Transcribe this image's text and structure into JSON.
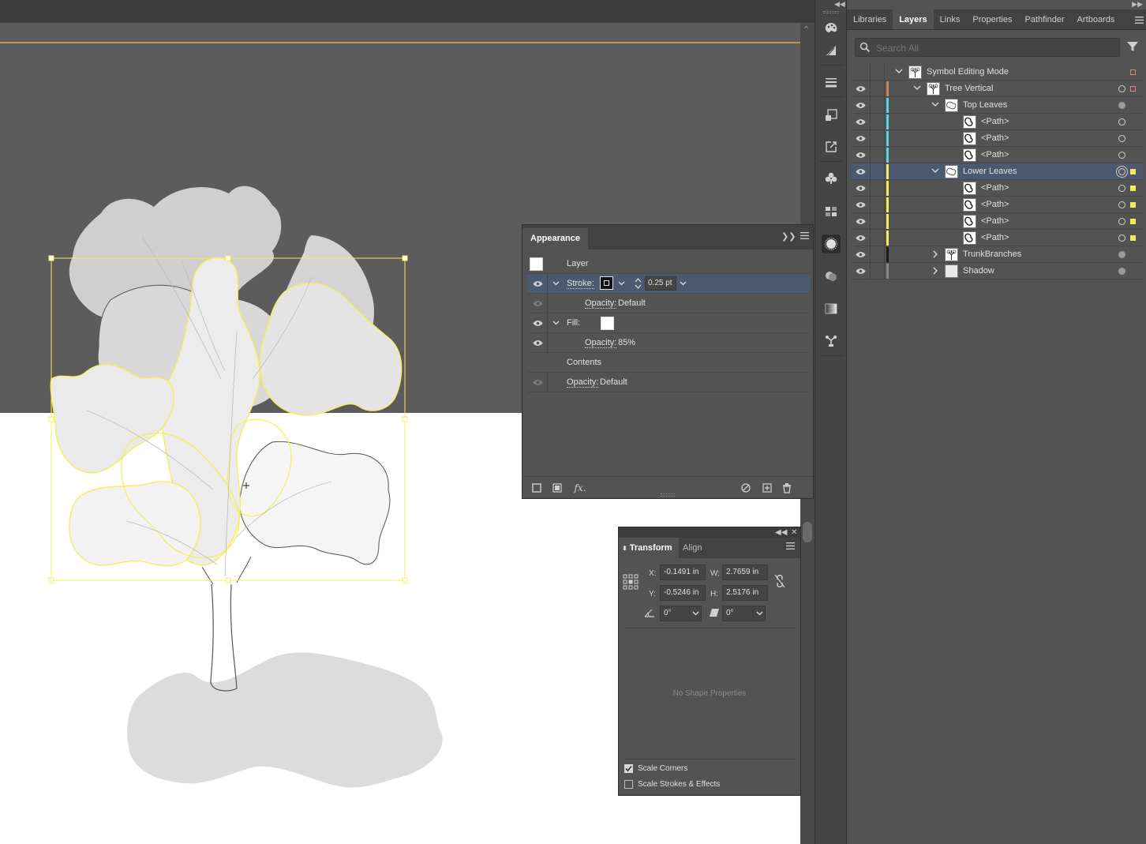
{
  "right_panel": {
    "tabs": [
      {
        "label": "Libraries",
        "active": false
      },
      {
        "label": "Layers",
        "active": true
      },
      {
        "label": "Links",
        "active": false
      },
      {
        "label": "Properties",
        "active": false
      },
      {
        "label": "Pathfinder",
        "active": false
      },
      {
        "label": "Artboards",
        "active": false
      }
    ],
    "search_placeholder": "Search All"
  },
  "layers": [
    {
      "name": "Symbol Editing Mode",
      "depth": 0,
      "expand": "open",
      "visible": false,
      "color": "",
      "target": "none",
      "selected_square": "#e08080",
      "thumb": "tree"
    },
    {
      "name": "Tree Vertical",
      "depth": 1,
      "expand": "open",
      "visible": true,
      "color": "#c8835a",
      "target": "ring-empty",
      "selected_square": "#e08080",
      "thumb": "tree"
    },
    {
      "name": "Top Leaves",
      "depth": 2,
      "expand": "open",
      "visible": true,
      "color": "#4fd8e8",
      "target": "filled",
      "selected_square": "",
      "thumb": "leaf"
    },
    {
      "name": "<Path>",
      "depth": 3,
      "expand": "none",
      "visible": true,
      "color": "#4fd8e8",
      "target": "empty",
      "selected_square": "",
      "thumb": "path"
    },
    {
      "name": "<Path>",
      "depth": 3,
      "expand": "none",
      "visible": true,
      "color": "#4fd8e8",
      "target": "empty",
      "selected_square": "",
      "thumb": "path"
    },
    {
      "name": "<Path>",
      "depth": 3,
      "expand": "none",
      "visible": true,
      "color": "#4fd8e8",
      "target": "empty",
      "selected_square": "",
      "thumb": "path"
    },
    {
      "name": "Lower Leaves",
      "depth": 2,
      "expand": "open",
      "visible": true,
      "color": "#f4ee55",
      "target": "ring",
      "selected_square": "#f4ee55",
      "thumb": "leaf",
      "selected": true
    },
    {
      "name": "<Path>",
      "depth": 3,
      "expand": "none",
      "visible": true,
      "color": "#f4ee55",
      "target": "empty",
      "selected_square": "#f4ee55",
      "thumb": "path"
    },
    {
      "name": "<Path>",
      "depth": 3,
      "expand": "none",
      "visible": true,
      "color": "#f4ee55",
      "target": "empty",
      "selected_square": "#f4ee55",
      "thumb": "path"
    },
    {
      "name": "<Path>",
      "depth": 3,
      "expand": "none",
      "visible": true,
      "color": "#f4ee55",
      "target": "empty",
      "selected_square": "#f4ee55",
      "thumb": "path"
    },
    {
      "name": "<Path>",
      "depth": 3,
      "expand": "none",
      "visible": true,
      "color": "#f4ee55",
      "target": "empty",
      "selected_square": "#f4ee55",
      "thumb": "path"
    },
    {
      "name": "TrunkBranches",
      "depth": 2,
      "expand": "closed",
      "visible": true,
      "color": "#1a1a1a",
      "target": "filled",
      "selected_square": "",
      "thumb": "tree"
    },
    {
      "name": "Shadow",
      "depth": 2,
      "expand": "closed",
      "visible": true,
      "color": "#8a8a8a",
      "target": "filled",
      "selected_square": "",
      "thumb": "blank"
    }
  ],
  "appearance": {
    "title": "Appearance",
    "layer_label": "Layer",
    "stroke_label": "Stroke:",
    "stroke_weight": "0.25 pt",
    "opacity_label": "Opacity:",
    "stroke_opacity": "Default",
    "fill_label": "Fill:",
    "fill_opacity": "85%",
    "contents_label": "Contents",
    "layer_opacity": "Default",
    "fx_label": "fx."
  },
  "transform": {
    "tabs": [
      "Transform",
      "Align"
    ],
    "x_label": "X:",
    "x_value": "-0.1491 in",
    "y_label": "Y:",
    "y_value": "-0.5246 in",
    "w_label": "W:",
    "w_value": "2.7659 in",
    "h_label": "H:",
    "h_value": "2.5176 in",
    "angle_value": "0°",
    "shear_value": "0°",
    "no_shape": "No Shape Properties",
    "scale_corners": "Scale Corners",
    "scale_corners_checked": true,
    "scale_strokes": "Scale Strokes & Effects",
    "scale_strokes_checked": false
  },
  "colors": {
    "selection": "#f4ee55",
    "top_leaves": "#4fd8e8",
    "trunk_layer": "#c8835a",
    "panel_bg": "#535353",
    "selected_row": "#4b5a70"
  }
}
